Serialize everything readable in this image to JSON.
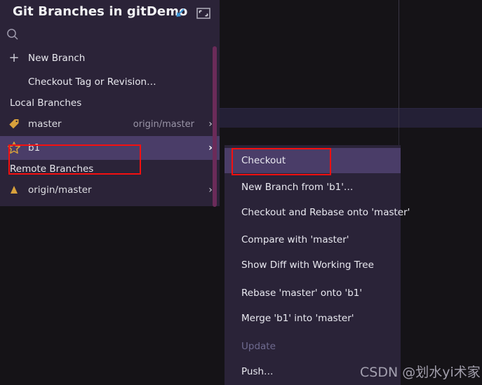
{
  "panel": {
    "title": "Git Branches in gitDemo",
    "header_icons": [
      {
        "name": "collapse-arrow-icon",
        "label": "Collapse"
      },
      {
        "name": "maximize-icon",
        "label": "Maximize"
      }
    ],
    "search": {
      "placeholder": "",
      "value": "",
      "icon": "search-icon"
    },
    "actions": [
      {
        "label": "New Branch",
        "icon": "plus-icon"
      },
      {
        "label": "Checkout Tag or Revision…",
        "icon": ""
      }
    ],
    "groups": [
      {
        "label": "Local Branches",
        "branches": [
          {
            "name": "master",
            "icon": "tag-icon",
            "tracking": "origin/master",
            "chevron": "›",
            "selected": false
          },
          {
            "name": "b1",
            "icon": "star-icon",
            "tracking": "",
            "chevron": "›",
            "selected": true
          }
        ]
      },
      {
        "label": "Remote Branches",
        "branches": [
          {
            "name": "origin/master",
            "icon": "remote-branch-icon",
            "tracking": "",
            "chevron": "›",
            "selected": false
          }
        ]
      }
    ],
    "scrollbar": {
      "name": "panel-scrollbar"
    }
  },
  "context_menu": {
    "items": [
      {
        "label": "Checkout",
        "highlighted": true,
        "disabled": false
      },
      {
        "label": "New Branch from 'b1'…",
        "highlighted": false,
        "disabled": false
      },
      {
        "label": "Checkout and Rebase onto 'master'",
        "highlighted": false,
        "disabled": false
      },
      {
        "label": "Compare with 'master'",
        "highlighted": false,
        "disabled": false
      },
      {
        "label": "Show Diff with Working Tree",
        "highlighted": false,
        "disabled": false
      },
      {
        "label": "Rebase 'master' onto 'b1'",
        "highlighted": false,
        "disabled": false
      },
      {
        "label": "Merge 'b1' into 'master'",
        "highlighted": false,
        "disabled": false
      },
      {
        "label": "Update",
        "highlighted": false,
        "disabled": true
      },
      {
        "label": "Push…",
        "highlighted": false,
        "disabled": false
      }
    ]
  },
  "annotations": {
    "branch_box": "b1 branch row highlight",
    "checkout_box": "Checkout menu item highlight"
  },
  "watermark": {
    "text": "CSDN @划水yi术家"
  },
  "colors": {
    "panel_bg": "#2b2338",
    "menu_bg": "#2a2338",
    "selection": "#4a3d68",
    "accent_gold": "#d8a13c",
    "scrollbar": "#6b2b59",
    "annotation_red": "#f41010",
    "editor_bg": "#151317",
    "disabled_text": "#6f6b90"
  }
}
